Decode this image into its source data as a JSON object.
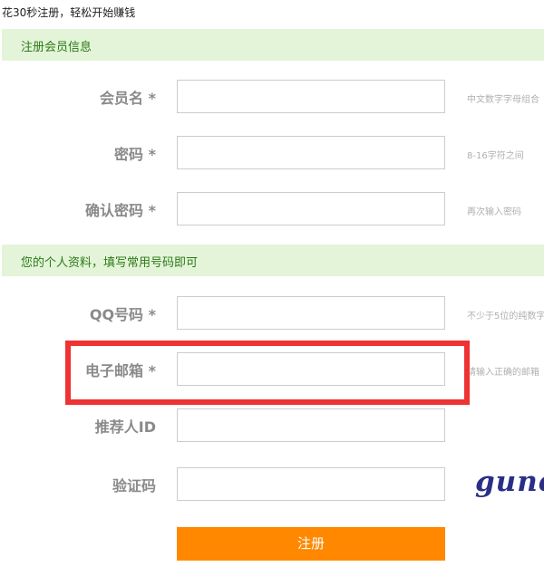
{
  "header": {
    "note": "花30秒注册，轻松开始赚钱"
  },
  "sections": {
    "account": {
      "title": "注册会员信息"
    },
    "profile": {
      "title": "您的个人资料，填写常用号码即可"
    }
  },
  "fields": {
    "username": {
      "label": "会员名 *",
      "value": "",
      "hint": "中文数字字母组合"
    },
    "password": {
      "label": "密码 *",
      "value": "",
      "hint": "8-16字符之间"
    },
    "confirm_password": {
      "label": "确认密码 *",
      "value": "",
      "hint": "再次输入密码"
    },
    "qq": {
      "label": "QQ号码 *",
      "value": "",
      "hint": "不少于5位的纯数字"
    },
    "email": {
      "label": "电子邮箱 *",
      "value": "",
      "hint": "请输入正确的邮箱"
    },
    "referrer": {
      "label": "推荐人ID",
      "value": ""
    },
    "captcha": {
      "label": "验证码",
      "value": "",
      "image_text": "gune"
    }
  },
  "submit": {
    "label": "注册"
  },
  "colors": {
    "section_bg": "#e3f4d9",
    "section_text": "#2c7a14",
    "submit_bg": "#ff8800",
    "highlight": "#ef3232",
    "captcha_text": "#2a2f86"
  }
}
